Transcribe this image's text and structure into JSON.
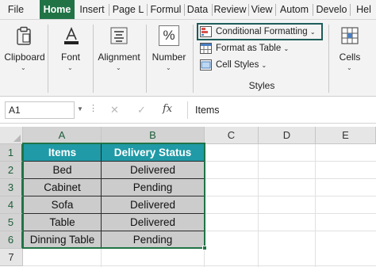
{
  "tabs": [
    {
      "label": "File",
      "active": false
    },
    {
      "label": "Home",
      "active": true
    },
    {
      "label": "Insert",
      "active": false
    },
    {
      "label": "Page L",
      "active": false
    },
    {
      "label": "Formul",
      "active": false
    },
    {
      "label": "Data",
      "active": false
    },
    {
      "label": "Review",
      "active": false
    },
    {
      "label": "View",
      "active": false
    },
    {
      "label": "Autom",
      "active": false
    },
    {
      "label": "Develo",
      "active": false
    },
    {
      "label": "Hel",
      "active": false
    }
  ],
  "ribbon": {
    "clipboard": {
      "label": "Clipboard",
      "icon": "clipboard-icon"
    },
    "font": {
      "label": "Font",
      "icon": "font-color-icon"
    },
    "alignment": {
      "label": "Alignment",
      "icon": "align-icon"
    },
    "number": {
      "label": "Number",
      "icon": "percent-icon",
      "glyph": "%"
    },
    "styles": {
      "conditional_formatting": "Conditional Formatting",
      "format_as_table": "Format as Table",
      "cell_styles": "Cell Styles",
      "group_label": "Styles"
    },
    "cells": {
      "label": "Cells",
      "icon": "cells-icon"
    }
  },
  "formula_bar": {
    "name_box": "A1",
    "cancel_glyph": "✕",
    "enter_glyph": "✓",
    "fx": "fx",
    "content": "Items"
  },
  "columns": [
    "A",
    "B",
    "C",
    "D",
    "E"
  ],
  "rows": [
    "1",
    "2",
    "3",
    "4",
    "5",
    "6",
    "7"
  ],
  "table": {
    "headers": [
      "Items",
      "Delivery Status"
    ],
    "rows": [
      [
        "Bed",
        "Delivered"
      ],
      [
        "Cabinet",
        "Pending"
      ],
      [
        "Sofa",
        "Delivered"
      ],
      [
        "Table",
        "Delivered"
      ],
      [
        "Dinning Table",
        "Pending"
      ]
    ]
  },
  "colors": {
    "accent": "#217346",
    "header_fill": "#1f9aa6",
    "body_fill": "#cccccc",
    "highlight_box": "#1e5d5a"
  }
}
